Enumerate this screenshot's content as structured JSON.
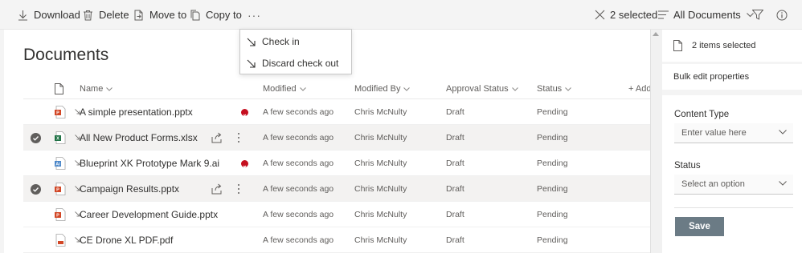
{
  "commandbar": {
    "download": "Download",
    "delete": "Delete",
    "move_to": "Move to",
    "copy_to": "Copy to",
    "more": "···",
    "selected": "2 selected",
    "view": "All Documents"
  },
  "menu": {
    "check_in": "Check in",
    "discard": "Discard check out"
  },
  "list": {
    "title": "Documents",
    "columns": {
      "name": "Name",
      "modified": "Modified",
      "modified_by": "Modified By",
      "approval": "Approval Status",
      "status": "Status",
      "add": "+ Add"
    },
    "rows": [
      {
        "name": "A simple presentation.pptx",
        "type": "pptx",
        "selected": false,
        "error": true,
        "modified": "A few seconds ago",
        "by": "Chris McNulty",
        "approval": "Draft",
        "status": "Pending"
      },
      {
        "name": "All New Product Forms.xlsx",
        "type": "xlsx",
        "selected": true,
        "error": false,
        "modified": "A few seconds ago",
        "by": "Chris McNulty",
        "approval": "Draft",
        "status": "Pending"
      },
      {
        "name": "Blueprint XK Prototype Mark 9.ai",
        "type": "ai",
        "selected": false,
        "error": true,
        "modified": "A few seconds ago",
        "by": "Chris McNulty",
        "approval": "Draft",
        "status": "Pending"
      },
      {
        "name": "Campaign Results.pptx",
        "type": "pptx",
        "selected": true,
        "error": false,
        "modified": "A few seconds ago",
        "by": "Chris McNulty",
        "approval": "Draft",
        "status": "Pending"
      },
      {
        "name": "Career Development Guide.pptx",
        "type": "pptx",
        "selected": false,
        "error": false,
        "modified": "A few seconds ago",
        "by": "Chris McNulty",
        "approval": "Draft",
        "status": "Pending"
      },
      {
        "name": "CE Drone XL PDF.pdf",
        "type": "pdf",
        "selected": false,
        "error": false,
        "modified": "A few seconds ago",
        "by": "Chris McNulty",
        "approval": "Draft",
        "status": "Pending"
      }
    ]
  },
  "pane": {
    "items_selected": "2 items selected",
    "bulk_edit": "Bulk edit properties",
    "content_type_label": "Content Type",
    "content_type_placeholder": "Enter value here",
    "status_label": "Status",
    "status_placeholder": "Select an option",
    "save": "Save"
  },
  "colors": {
    "pptx": "#d24726",
    "xlsx": "#217346",
    "ai": "#4a86c8",
    "pdf": "#d24726",
    "error": "#c50f1f",
    "save_button": "#6b7b85"
  }
}
